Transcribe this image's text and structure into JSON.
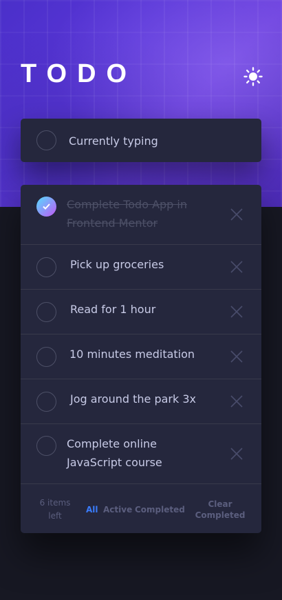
{
  "header": {
    "title": "TODO"
  },
  "new_todo": {
    "value": "Currently typing"
  },
  "todos": [
    {
      "text": "Complete Todo App in Frontend Mentor",
      "completed": true
    },
    {
      "text": "Pick up groceries",
      "completed": false
    },
    {
      "text": "Read for 1 hour",
      "completed": false
    },
    {
      "text": "10 minutes meditation",
      "completed": false
    },
    {
      "text": "Jog around the park 3x",
      "completed": false
    },
    {
      "text": "Complete online JavaScript course",
      "completed": false
    }
  ],
  "footer": {
    "items_left": "6 items left",
    "filters": [
      "All",
      "Active",
      "Completed"
    ],
    "active_filter": "All",
    "clear_label": "Clear Completed"
  },
  "colors": {
    "accent": "#3a7cfd",
    "check_gradient_start": "#55ddff",
    "check_gradient_end": "#c058f3"
  },
  "icons": {
    "theme_toggle": "sun-icon",
    "delete": "cross-icon",
    "check": "check-icon"
  }
}
